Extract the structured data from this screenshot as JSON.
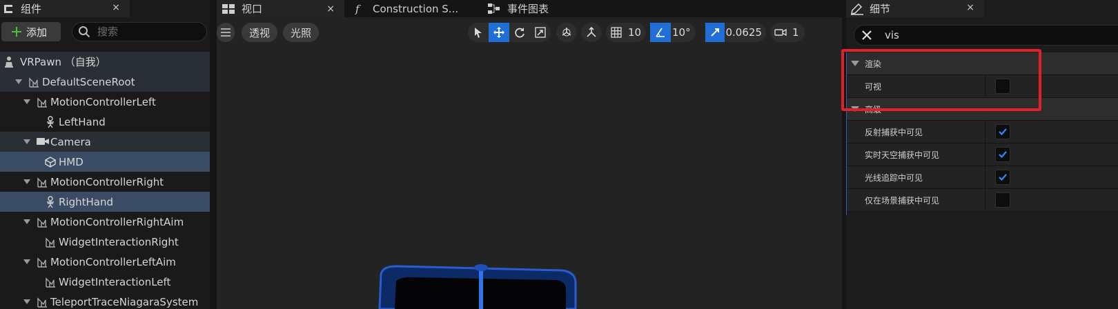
{
  "components": {
    "tab_title": "组件",
    "close_glyph": "×",
    "add_label": "添加",
    "search_placeholder": "搜索",
    "tree": [
      {
        "label": "VRPawn （自我）",
        "icon": "pawn-icon",
        "level": 0,
        "arrow": false,
        "state": "hl"
      },
      {
        "label": "DefaultSceneRoot",
        "icon": "scene-component-icon",
        "level": 1,
        "arrow": true,
        "state": "hl"
      },
      {
        "label": "MotionControllerLeft",
        "icon": "scene-component-icon",
        "level": 2,
        "arrow": true,
        "state": ""
      },
      {
        "label": "LeftHand",
        "icon": "skeletal-mesh-icon",
        "level": 3,
        "arrow": false,
        "state": ""
      },
      {
        "label": "Camera",
        "icon": "camera-icon",
        "level": 2,
        "arrow": true,
        "state": "hl"
      },
      {
        "label": "HMD",
        "icon": "static-mesh-icon",
        "level": 3,
        "arrow": false,
        "state": "sel"
      },
      {
        "label": "MotionControllerRight",
        "icon": "scene-component-icon",
        "level": 2,
        "arrow": true,
        "state": ""
      },
      {
        "label": "RightHand",
        "icon": "skeletal-mesh-icon",
        "level": 3,
        "arrow": false,
        "state": "sel"
      },
      {
        "label": "MotionControllerRightAim",
        "icon": "scene-component-icon",
        "level": 2,
        "arrow": true,
        "state": ""
      },
      {
        "label": "WidgetInteractionRight",
        "icon": "scene-component-icon",
        "level": 3,
        "arrow": false,
        "state": ""
      },
      {
        "label": "MotionControllerLeftAim",
        "icon": "scene-component-icon",
        "level": 2,
        "arrow": true,
        "state": ""
      },
      {
        "label": "WidgetInteractionLeft",
        "icon": "scene-component-icon",
        "level": 3,
        "arrow": false,
        "state": ""
      },
      {
        "label": "TeleportTraceNiagaraSystem",
        "icon": "scene-component-icon",
        "level": 2,
        "arrow": true,
        "state": ""
      }
    ]
  },
  "viewport": {
    "tabs": [
      {
        "label": "视口",
        "icon": "viewport-icon"
      },
      {
        "label": "Construction S...",
        "icon": "function-icon"
      },
      {
        "label": "事件图表",
        "icon": "event-graph-icon"
      }
    ],
    "perspective_label": "透视",
    "lighting_label": "光照",
    "grid_snap_value": "10",
    "rotation_snap_value": "10°",
    "scale_snap_value": "0.0625",
    "camera_speed_value": "1"
  },
  "details": {
    "tab_title": "细节",
    "search_value": "vis",
    "categories": [
      {
        "label": "渲染",
        "items": [
          {
            "label": "可视",
            "checked": false
          }
        ]
      },
      {
        "label": "高级",
        "items": [
          {
            "label": "反射捕获中可见",
            "checked": true
          },
          {
            "label": "实时天空捕获中可见",
            "checked": true
          },
          {
            "label": "光线追踪中可见",
            "checked": true
          },
          {
            "label": "仅在场景捕获中可见",
            "checked": false
          }
        ]
      }
    ]
  },
  "colors": {
    "accent_blue": "#1f6fd6",
    "selection": "#3a4c63",
    "highlight_box": "#e2202a",
    "add_plus": "#4fbf3a"
  }
}
